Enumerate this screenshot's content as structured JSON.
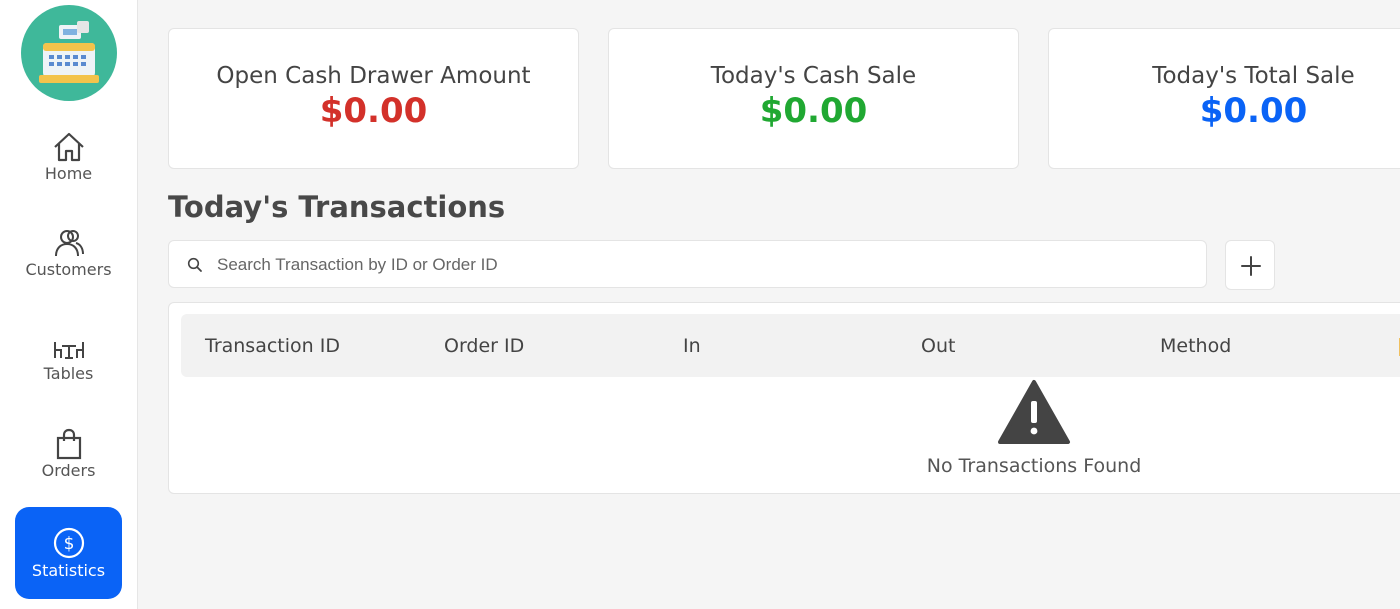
{
  "sidebar": {
    "items": [
      {
        "label": "Home",
        "icon": "home-icon"
      },
      {
        "label": "Customers",
        "icon": "customers-icon"
      },
      {
        "label": "Tables",
        "icon": "tables-icon"
      },
      {
        "label": "Orders",
        "icon": "bag-icon"
      },
      {
        "label": "Statistics",
        "icon": "dollar-circle-icon",
        "active": true
      }
    ]
  },
  "cards": [
    {
      "title": "Open Cash Drawer Amount",
      "value": "$0.00",
      "color": "#d3312a"
    },
    {
      "title": "Today's Cash Sale",
      "value": "$0.00",
      "color": "#20a832"
    },
    {
      "title": "Today's Total Sale",
      "value": "$0.00",
      "color": "#0a63f6"
    }
  ],
  "transactions": {
    "title": "Today's Transactions",
    "search_placeholder": "Search Transaction by ID or Order ID",
    "search_value": "",
    "columns": [
      "Transaction ID",
      "Order ID",
      "In",
      "Out",
      "Method"
    ],
    "rows": [],
    "empty_message": "No Transactions Found"
  },
  "colors": {
    "accent": "#0a63f6",
    "logo_bg": "#3fb89a"
  }
}
